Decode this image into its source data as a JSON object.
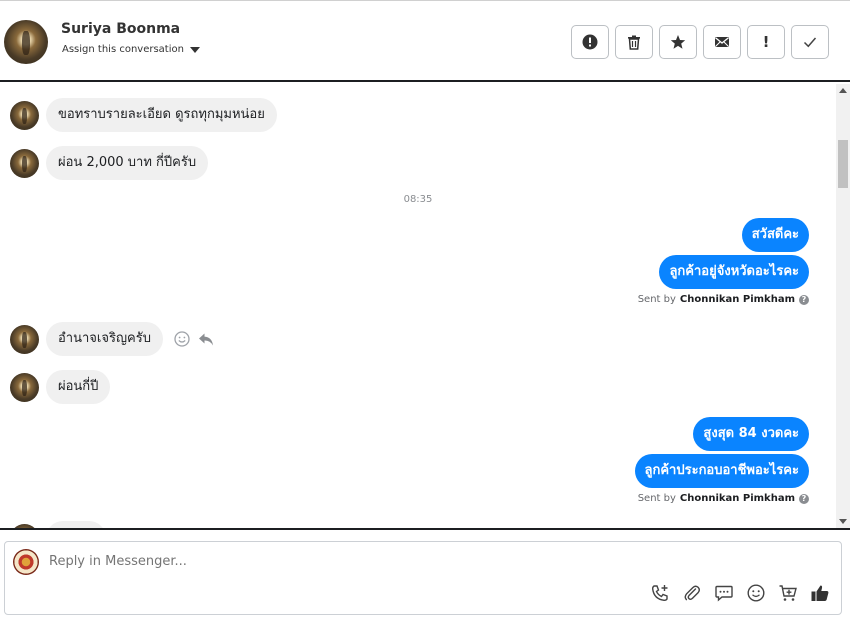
{
  "header": {
    "contact_name": "Suriya Boonma",
    "assign_label": "Assign this conversation",
    "actions": [
      {
        "name": "report-spam-button",
        "icon": "alert-circle-icon"
      },
      {
        "name": "delete-button",
        "icon": "trash-icon"
      },
      {
        "name": "star-button",
        "icon": "star-icon"
      },
      {
        "name": "mark-unread-button",
        "icon": "envelope-icon"
      },
      {
        "name": "follow-up-button",
        "icon": "exclamation-icon",
        "glyph": "!"
      },
      {
        "name": "mark-done-button",
        "icon": "check-icon"
      }
    ]
  },
  "messages": {
    "incoming_1": "ขอทราบรายละเอียด ดูรถทุกมุมหน่อย",
    "incoming_2": "ผ่อน 2,000 บาท กี่ปีครับ",
    "timestamp": "08:35",
    "outgoing_1": "สวัสดีคะ",
    "outgoing_2": "ลูกค้าอยู่จังหวัดอะไรคะ",
    "sent_by_prefix": "Sent by",
    "sent_by_name": "Chonnikan Pimkham",
    "incoming_3": "อำนาจเจริญครับ",
    "incoming_4": "ผ่อนกี่ปี",
    "outgoing_3": "สูงสุด 84 งวดคะ",
    "outgoing_4": "ลูกค้าประกอบอาชีพอะไรคะ",
    "sent_by_prefix_2": "Sent by",
    "sent_by_name_2": "Chonnikan Pimkham",
    "help_icon_glyph": "?"
  },
  "composer": {
    "placeholder": "Reply in Messenger...",
    "tools": [
      "call-add-icon",
      "paperclip-icon",
      "saved-reply-icon",
      "emoji-icon",
      "cart-icon",
      "like-icon"
    ]
  },
  "colors": {
    "outgoing_bubble": "#0a84ff",
    "incoming_bubble": "#f0f0f0",
    "divider": "#1c1e21"
  }
}
